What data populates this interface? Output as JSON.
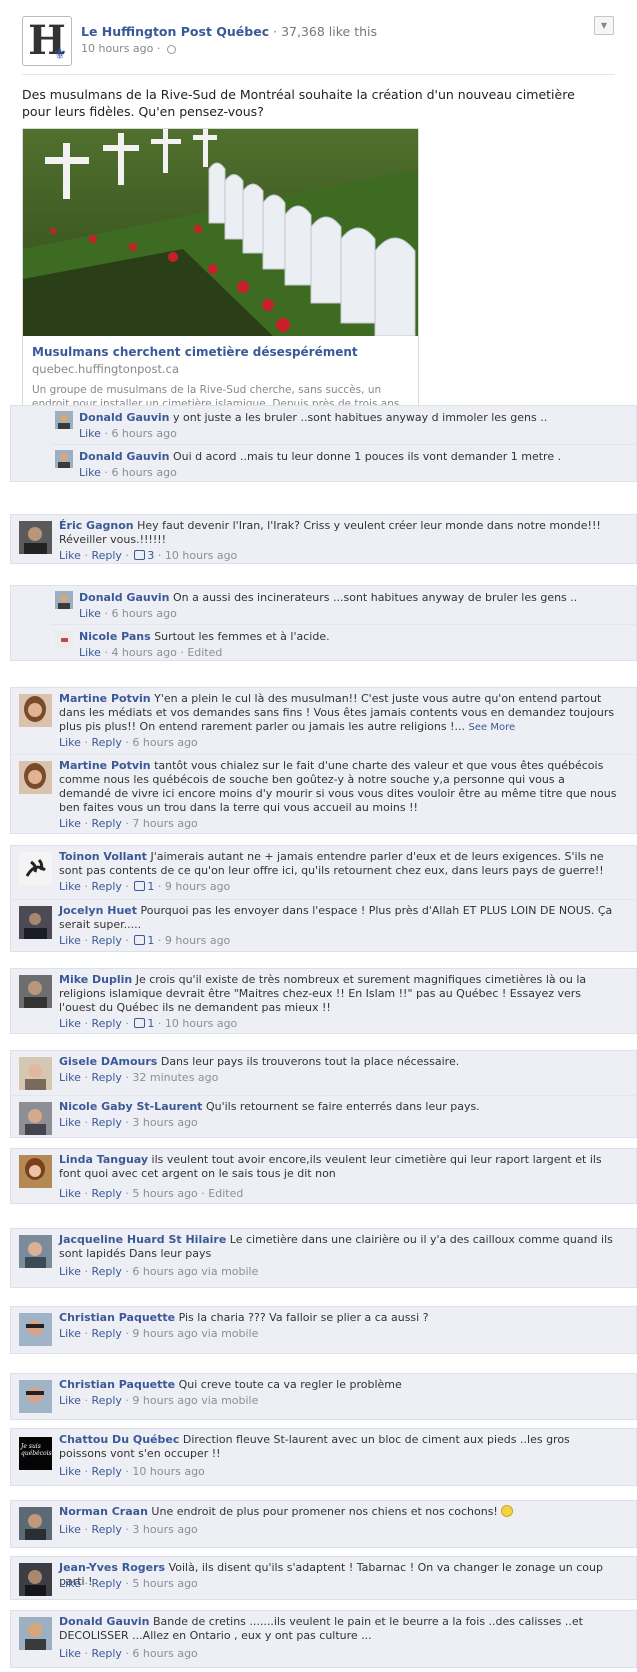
{
  "post": {
    "page_name": "Le Huffington Post Québec",
    "likes_text": "37,368 like this",
    "time": "10 hours ago",
    "separator": "·",
    "message": "Des musulmans de la Rive-Sud de Montréal souhaite la création d'un nouveau cimetière pour leurs fidèles. Qu'en pensez-vous?",
    "link": {
      "title": "Musulmans cherchent cimetière désespérément",
      "domain": "quebec.huffingtonpost.ca",
      "description": "Un groupe de musulmans de la Rive-Sud cherche, sans succès, un endroit pour installer un cimetière islamique. Depuis près de trois ans, ils tentent d'acquérir un terrain alors que l'unique cimetière musulman de la province, situé à Laval,"
    }
  },
  "labels": {
    "like": "Like",
    "reply": "Reply",
    "see_more": "See More",
    "dot": "·"
  },
  "comments": {
    "c1": {
      "name": "Donald Gauvin",
      "text": "y ont juste a les bruler ..sont habitues anyway d immoler les gens ..",
      "time": "6 hours ago"
    },
    "c2": {
      "name": "Donald Gauvin",
      "text": "Oui d acord ..mais tu leur donne 1 pouces ils vont demander 1 metre .",
      "time": "6 hours ago"
    },
    "c3": {
      "name": "Éric Gagnon",
      "text": "Hey faut devenir l'Iran, l'Irak? Criss y veulent créer leur monde dans notre monde!!! Réveiller vous.!!!!!!",
      "likes": "3",
      "time": "10 hours ago"
    },
    "c4": {
      "name": "Donald Gauvin",
      "text": "On a aussi des incinerateurs ...sont habitues anyway de bruler les gens ..",
      "time": "6 hours ago"
    },
    "c5": {
      "name": "Nicole Pans",
      "text": "Surtout les femmes et à l'acide.",
      "time": "4 hours ago",
      "edited": "Edited"
    },
    "c6": {
      "name": "Martine Potvin",
      "text": "Y'en a plein le cul là des musulman!! C'est juste vous autre qu'on entend partout dans les médiats et vos demandes sans fins ! Vous êtes jamais contents vous en demandez toujours plus pis plus!! On entend rarement parler ou jamais les autre religions !...",
      "time": "6 hours ago"
    },
    "c7": {
      "name": "Martine Potvin",
      "text": "tantôt vous chialez sur le fait d'une charte des valeur et que vous êtes québécois comme nous les québécois de souche ben goûtez-y à notre souche y,a personne qui vous a demandé de vivre ici encore moins d'y mourir si vous vous dites vouloir être au même titre que nous ben faites vous un trou dans la terre qui vous accueil au moins !!",
      "time": "7 hours ago"
    },
    "c8": {
      "name": "Toinon Vollant",
      "text": "J'aimerais autant ne + jamais entendre parler d'eux et de leurs exigences. S'ils ne sont pas contents de ce qu'on leur offre ici, qu'ils retournent chez eux, dans leurs pays de guerre!!",
      "likes": "1",
      "time": "9 hours ago"
    },
    "c9": {
      "name": "Jocelyn Huet",
      "text": "Pourquoi pas les envoyer dans l'espace ! Plus près d'Allah ET PLUS LOIN DE NOUS. Ça serait super.....",
      "likes": "1",
      "time": "9 hours ago"
    },
    "c10": {
      "name": "Mike Duplin",
      "text": "Je crois qu'il existe de très nombreux et surement magnifiques cimetières là ou la religions islamique devrait être \"Maitres chez-eux !! En Islam !!\" pas au Québec ! Essayez vers l'ouest du Québec ils ne demandent pas mieux !!",
      "likes": "1",
      "time": "10 hours ago"
    },
    "c11": {
      "name": "Gisele DAmours",
      "text": "Dans leur pays ils trouverons tout la place nécessaire.",
      "time": "32 minutes ago"
    },
    "c12": {
      "name": "Nicole Gaby St-Laurent",
      "text": "Qu'ils retournent se faire enterrés dans leur pays.",
      "time": "3 hours ago"
    },
    "c13": {
      "name": "Linda Tanguay",
      "text": "ils veulent tout avoir encore,ils veulent leur cimetière qui leur raport largent et ils font quoi avec cet argent on le sais tous je dit non",
      "time": "5 hours ago",
      "edited": "Edited"
    },
    "c14": {
      "name": "Jacqueline Huard St Hilaire",
      "text": "Le cimetière dans une clairière ou il y'a des cailloux comme quand ils sont lapidés Dans leur pays",
      "time": "6 hours ago via mobile"
    },
    "c15": {
      "name": "Christian Paquette",
      "text": "Pis la charia ??? Va falloir se plier a ca aussi ?",
      "time": "9 hours ago via mobile"
    },
    "c16": {
      "name": "Christian Paquette",
      "text": "Qui creve toute ca va regler le problème",
      "time": "9 hours ago via mobile"
    },
    "c17": {
      "name": "Chattou Du Québec",
      "text": "Direction fleuve St-laurent avec un bloc de ciment aux pieds ..les gros poissons vont s'en occuper !!",
      "time": "10 hours ago",
      "avatar_text": "Je suis québécoise"
    },
    "c18": {
      "name": "Norman Craan",
      "text": "Une endroit de plus pour promener nos chiens et nos cochons!",
      "time": "3 hours ago"
    },
    "c19": {
      "name": "Jean-Yves Rogers",
      "text": "Voilà, ils disent qu'ils s'adaptent ! Tabarnac ! On va changer le zonage un coup parti !",
      "time": "5 hours ago"
    },
    "c20": {
      "name": "Donald Gauvin",
      "text": "Bande de cretins .......ils veulent le pain et le beurre a la fois ..des calisses ..et DECOLISSER ...Allez en Ontario , eux y ont pas culture ...",
      "time": "6 hours ago"
    }
  },
  "colors": {
    "link": "#3b5998",
    "comment_bg": "#edeff4",
    "meta": "#898f9c"
  }
}
